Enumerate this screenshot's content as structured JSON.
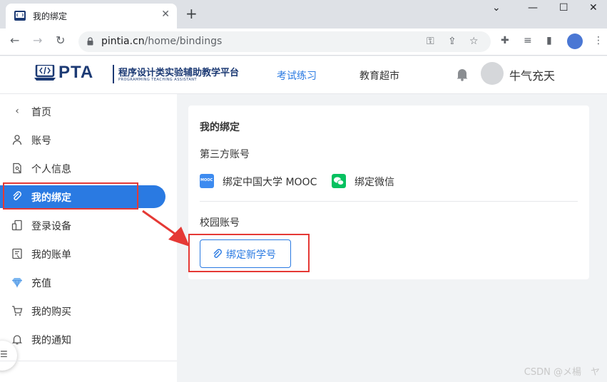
{
  "browser": {
    "tab_title": "我的绑定",
    "tab_close": "✕",
    "new_tab": "+",
    "url_host": "pintia.cn",
    "url_path": "/home/bindings",
    "win_min": "⌄",
    "win_minimize": "—",
    "win_maximize": "☐",
    "win_close": "✕"
  },
  "header": {
    "logo_text": "PTA",
    "logo_cn": "程序设计类实验辅助教学平台",
    "logo_en": "PROGRAMMING TEACHING ASSISTANT",
    "nav": [
      {
        "label": "考试练习",
        "active": true
      },
      {
        "label": "教育超市",
        "active": false
      }
    ],
    "username": "牛气充天"
  },
  "sidebar": {
    "items": [
      {
        "label": "首页",
        "icon": "chevron-left-icon",
        "active": false
      },
      {
        "label": "账号",
        "icon": "user-icon",
        "active": false
      },
      {
        "label": "个人信息",
        "icon": "profile-card-icon",
        "active": false
      },
      {
        "label": "我的绑定",
        "icon": "paperclip-icon",
        "active": true
      },
      {
        "label": "登录设备",
        "icon": "devices-icon",
        "active": false
      },
      {
        "label": "我的账单",
        "icon": "bill-icon",
        "active": false
      },
      {
        "label": "充值",
        "icon": "diamond-icon",
        "active": false
      },
      {
        "label": "我的购买",
        "icon": "cart-icon",
        "active": false
      },
      {
        "label": "我的通知",
        "icon": "bell-icon",
        "active": false
      }
    ]
  },
  "card": {
    "title": "我的绑定",
    "third_party_title": "第三方账号",
    "mooc_label": "绑定中国大学 MOOC",
    "mooc_icon_text": "MOOC",
    "wechat_label": "绑定微信",
    "campus_title": "校园账号",
    "bind_button": "绑定新学号"
  },
  "colors": {
    "accent": "#2a7ae2",
    "brand": "#1c3a74",
    "annotation": "#e53935",
    "wechat": "#07c160"
  },
  "watermark": "CSDN @メ楊　ヤ"
}
